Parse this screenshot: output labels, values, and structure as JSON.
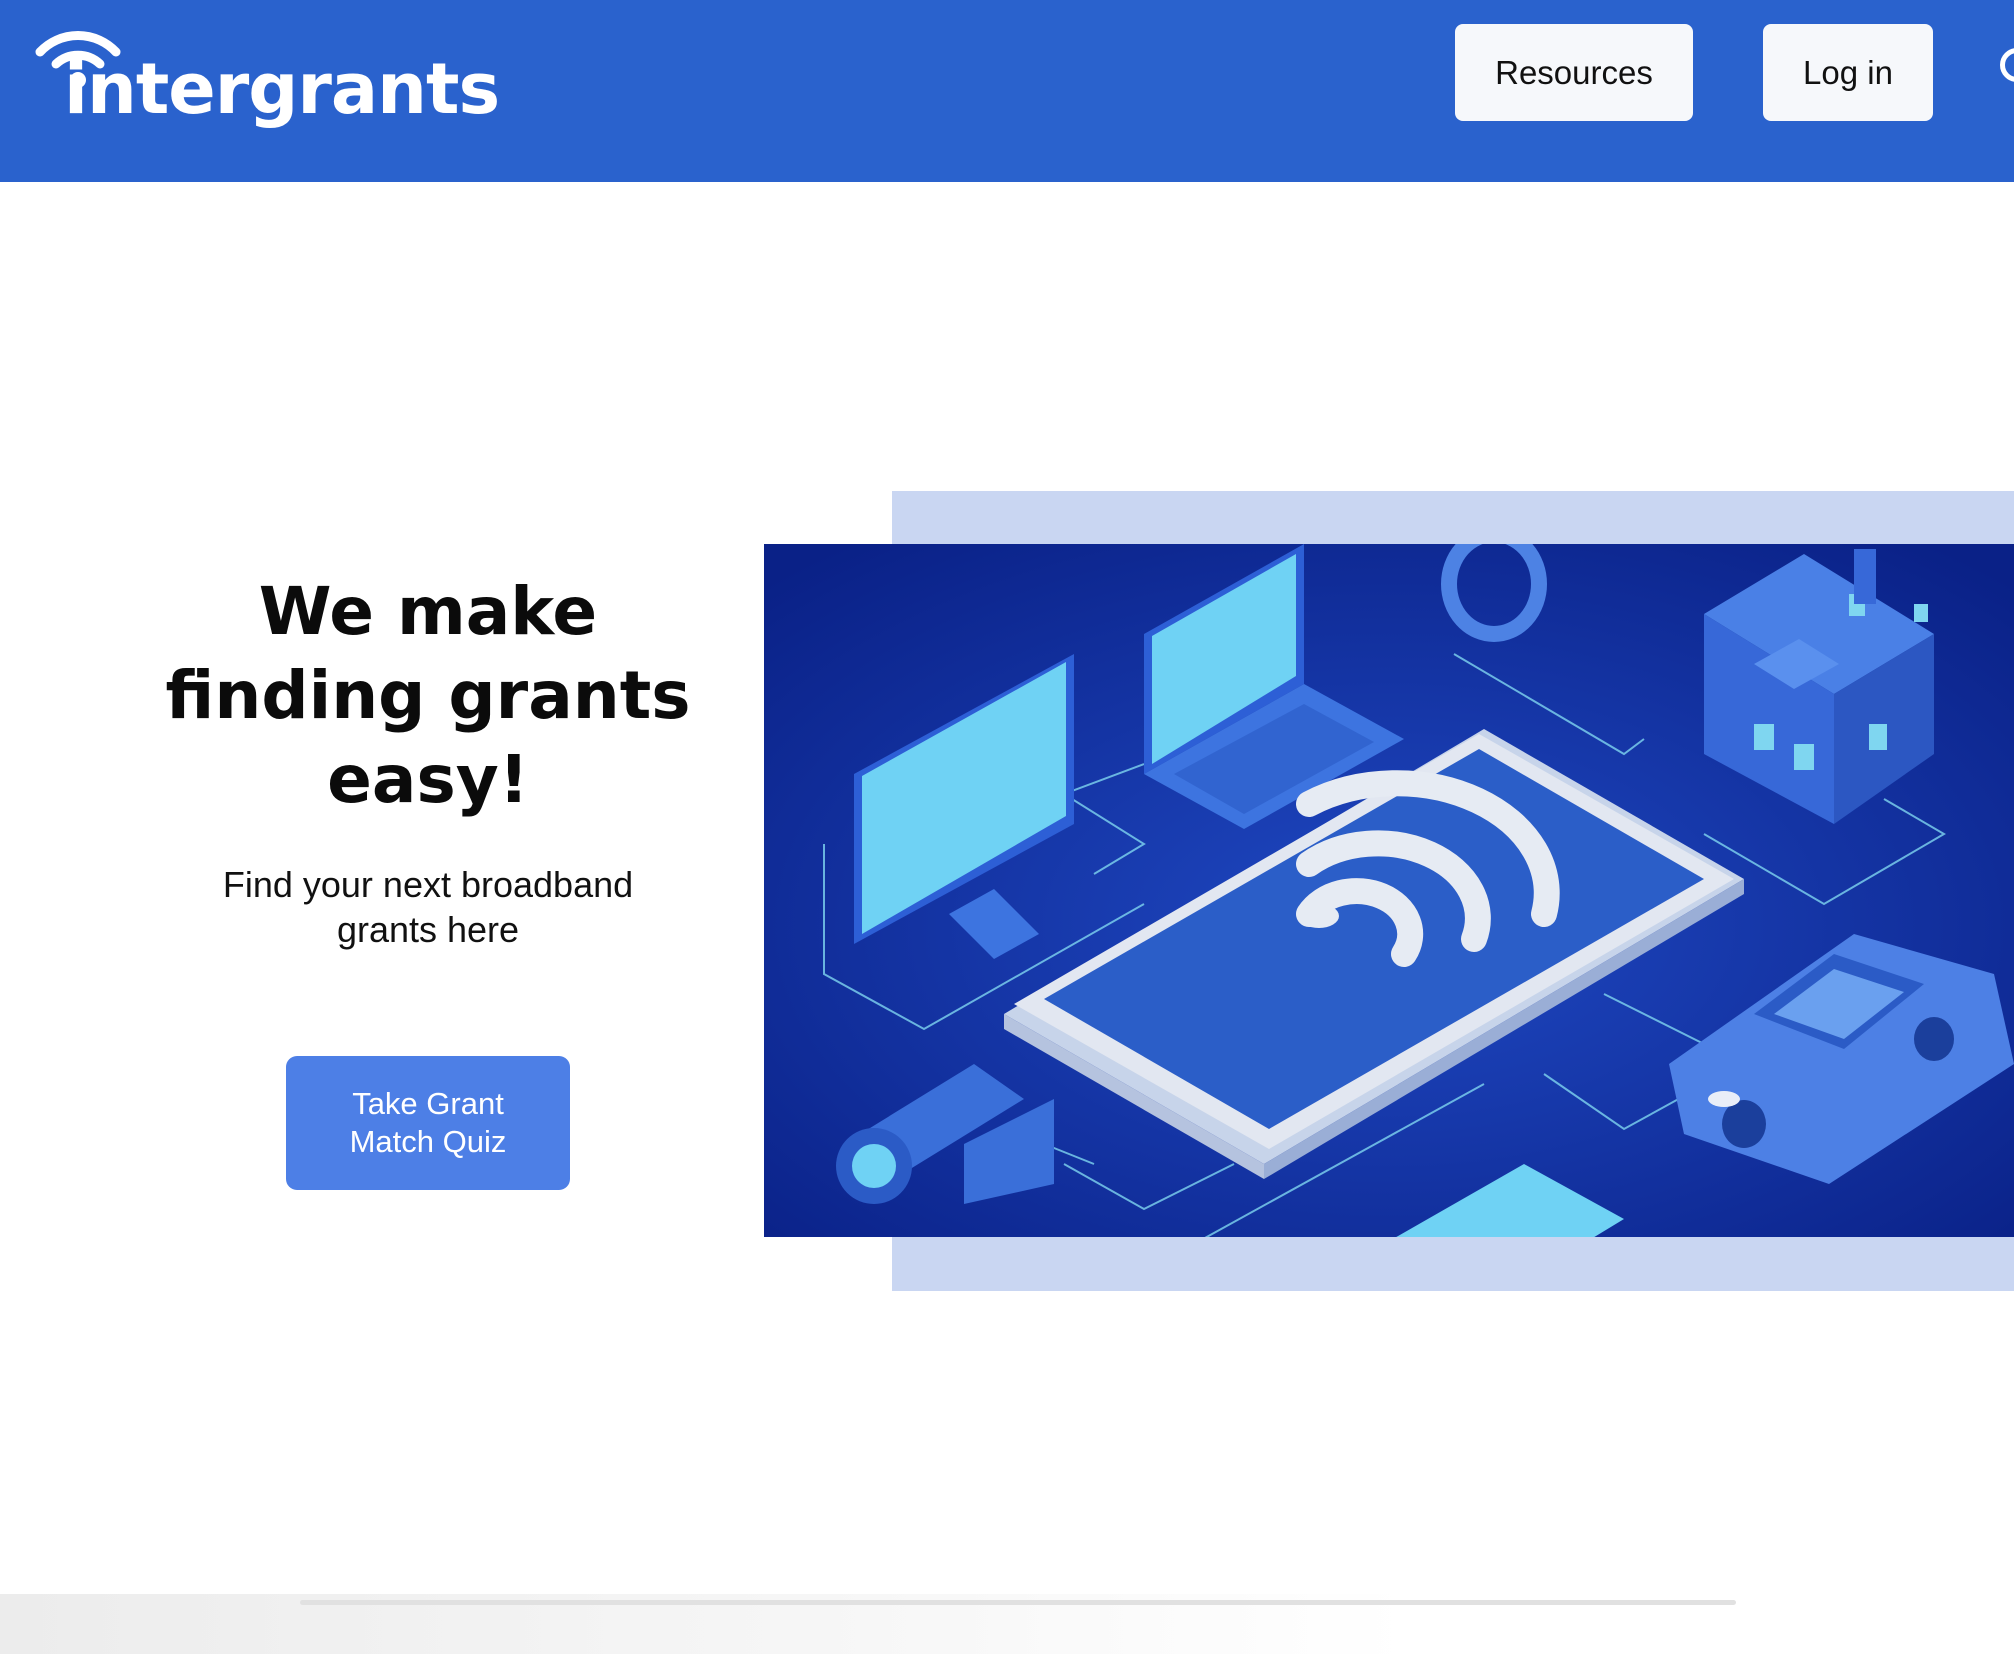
{
  "header": {
    "logo_text": "intergrants",
    "nav": {
      "resources_label": "Resources",
      "login_label": "Log in"
    }
  },
  "hero": {
    "title": "We make finding grants easy!",
    "subtitle": "Find your next broadband grants here",
    "cta_label": "Take Grant Match Quiz"
  },
  "colors": {
    "header_bg": "#2a62cd",
    "cta_bg": "#4d7fe6",
    "image_backdrop": "#c9d6f2",
    "illustration_bg": "#0d2a92"
  }
}
